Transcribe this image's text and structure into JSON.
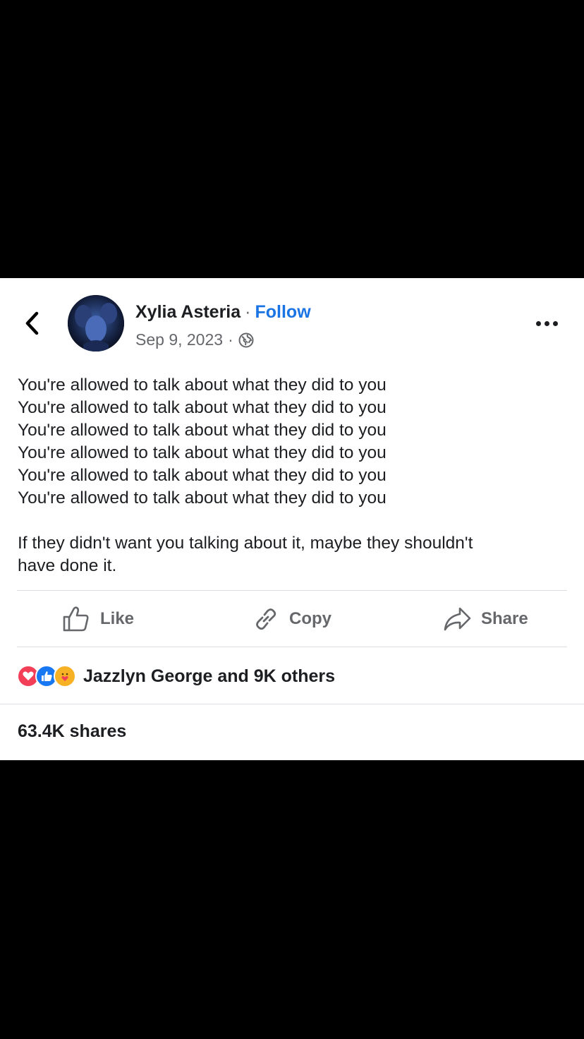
{
  "post": {
    "author": "Xylia Asteria",
    "separator": "·",
    "follow_label": "Follow",
    "date": "Sep 9, 2023",
    "audience_icon": "globe-icon",
    "lines": [
      "You're allowed to talk about what they did to you",
      "You're allowed to talk about what they did to you",
      "You're allowed to talk about what they did to you",
      "You're allowed to talk about what they did to you",
      "You're allowed to talk about what they did to you",
      "You're allowed to talk about what they did to you"
    ],
    "closing_line_1": "If they didn't want you talking about it, maybe they shouldn't",
    "closing_line_2": "have done it."
  },
  "actions": {
    "like": "Like",
    "copy": "Copy",
    "share": "Share"
  },
  "reactions": {
    "types": [
      "love",
      "like",
      "care"
    ],
    "summary": "Jazzlyn George and 9K others"
  },
  "shares": "63.4K shares",
  "colors": {
    "accent": "#1b74e4",
    "love": "#f33e58",
    "like": "#1877f2",
    "care": "#f7b125",
    "muted_text": "#65676b"
  }
}
